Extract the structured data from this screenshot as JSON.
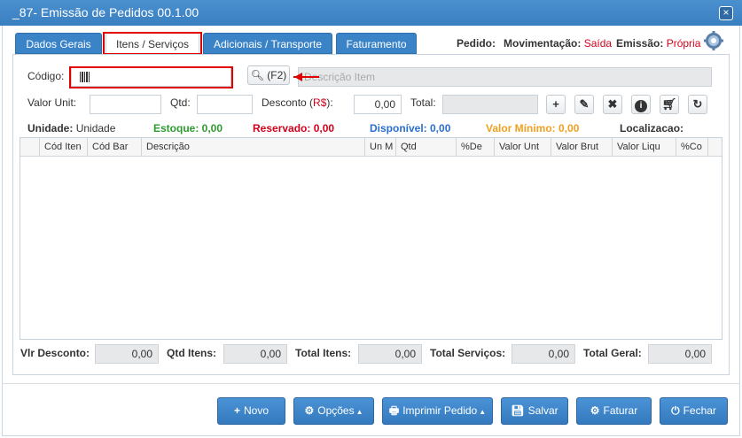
{
  "window": {
    "title": "_87- Emissão de Pedidos 00.1.00",
    "close_glyph": "×"
  },
  "tabs": [
    {
      "label": "Dados Gerais"
    },
    {
      "label": "Itens / Serviços"
    },
    {
      "label": "Adicionais / Transporte"
    },
    {
      "label": "Faturamento"
    }
  ],
  "header": {
    "pedido_label": "Pedido:",
    "movimentacao_label": "Movimentação:",
    "movimentacao_value": "Saída",
    "emissao_label": "Emissão:",
    "emissao_value": "Própria"
  },
  "form": {
    "codigo_label": "Código:",
    "codigo_value": "",
    "search_label": "(F2)",
    "descricao_placeholder": "Descrição Item",
    "valor_unit_label": "Valor Unit:",
    "valor_unit_value": "",
    "qtd_label": "Qtd:",
    "qtd_value": "",
    "desconto_label": "Desconto (",
    "desconto_currency": "R$",
    "desconto_suffix": "):",
    "desconto_value": "0,00",
    "total_label": "Total:",
    "total_value": ""
  },
  "info_row": {
    "unidade_label": "Unidade:",
    "unidade_value": "Unidade",
    "estoque": "Estoque: 0,00",
    "reservado": "Reservado: 0,00",
    "disponivel": "Disponível: 0,00",
    "valor_minimo": "Valor Mínimo: 0,00",
    "localizacao": "Localizacao:"
  },
  "grid": {
    "columns": [
      "Cód Iten",
      "Cód Bar",
      "Descrição",
      "Un M",
      "Qtd",
      "%De",
      "Valor Unt",
      "Valor Brut",
      "Valor Liqu",
      "%Co"
    ]
  },
  "totals": {
    "vlr_desconto_label": "Vlr Desconto:",
    "vlr_desconto_value": "0,00",
    "qtd_itens_label": "Qtd Itens:",
    "qtd_itens_value": "0,00",
    "total_itens_label": "Total Itens:",
    "total_itens_value": "0,00",
    "total_servicos_label": "Total Serviços:",
    "total_servicos_value": "0,00",
    "total_geral_label": "Total Geral:",
    "total_geral_value": "0,00"
  },
  "buttons": {
    "novo": "Novo",
    "opcoes": "Opções",
    "imprimir": "Imprimir Pedido",
    "salvar": "Salvar",
    "faturar": "Faturar",
    "fechar": "Fechar"
  },
  "colors": {
    "primary": "#3b83c7",
    "highlight_box": "#e00000",
    "estoque": "#2e9a2e",
    "reservado": "#d0021b",
    "disponivel": "#2b6fcf",
    "valor_minimo": "#f0a020"
  }
}
